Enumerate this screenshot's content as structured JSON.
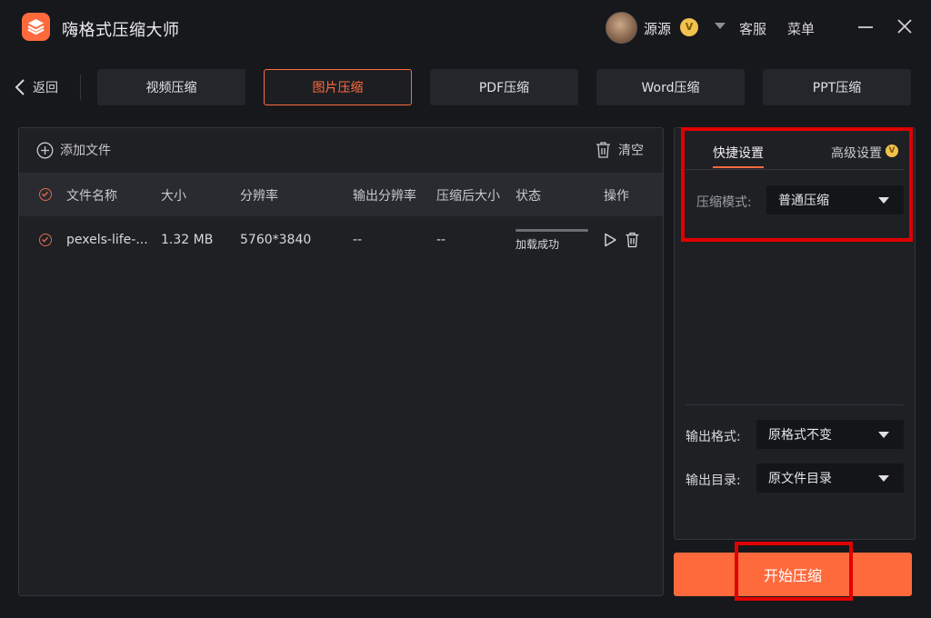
{
  "app": {
    "title": "嗨格式压缩大师"
  },
  "user": {
    "name": "源源",
    "badge": "V"
  },
  "header_links": {
    "service": "客服",
    "menu": "菜单"
  },
  "nav": {
    "back_label": "返回",
    "tabs": [
      {
        "label": "视频压缩",
        "active": false
      },
      {
        "label": "图片压缩",
        "active": true
      },
      {
        "label": "PDF压缩",
        "active": false
      },
      {
        "label": "Word压缩",
        "active": false
      },
      {
        "label": "PPT压缩",
        "active": false
      }
    ]
  },
  "file_panel": {
    "add_label": "添加文件",
    "clear_label": "清空",
    "columns": [
      "文件名称",
      "大小",
      "分辨率",
      "输出分辨率",
      "压缩后大小",
      "状态",
      "操作"
    ],
    "rows": [
      {
        "name": "pexels-life-...",
        "size": "1.32 MB",
        "resolution": "5760*3840",
        "output_resolution": "--",
        "compressed_size": "--",
        "status": "加载成功",
        "progress": 1.0
      }
    ]
  },
  "settings": {
    "tab_quick": "快捷设置",
    "tab_advanced": "高级设置",
    "advanced_badge": "V",
    "mode_label": "压缩模式:",
    "mode_value": "普通压缩",
    "format_label": "输出格式:",
    "format_value": "原格式不变",
    "dir_label": "输出目录:",
    "dir_value": "原文件目录"
  },
  "start_button": "开始压缩",
  "colors": {
    "accent": "#ff6a3d",
    "highlight": "#e00000",
    "background": "#17181c",
    "panel": "#1f2024"
  }
}
